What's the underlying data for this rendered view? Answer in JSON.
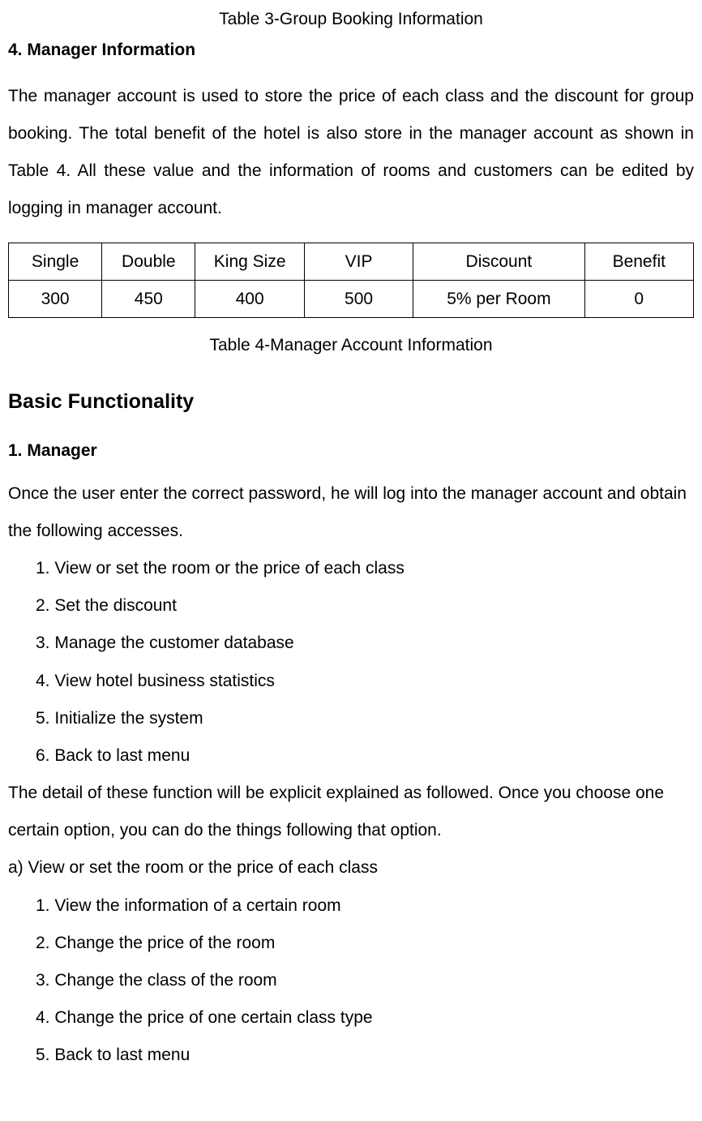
{
  "caption_top": "Table 3-Group Booking Information",
  "section4_heading": "4. Manager Information",
  "section4_para": "The manager account is used to store the price of each class and the discount for group booking. The total benefit of the hotel is also store in the manager account as shown in Table 4. All these value and the information of rooms and customers can be edited by logging in manager account.",
  "chart_data": {
    "type": "table",
    "headers": [
      "Single",
      "Double",
      "King Size",
      "VIP",
      "Discount",
      "Benefit"
    ],
    "rows": [
      [
        "300",
        "450",
        "400",
        "500",
        "5% per Room",
        "0"
      ]
    ],
    "caption": "Table 4-Manager Account Information"
  },
  "basic_heading": "Basic Functionality",
  "manager_heading": "1. Manager",
  "manager_intro": "Once the user enter the correct password, he will log into the manager account and obtain the following accesses.",
  "manager_list": [
    "1. View or set the room or the price of each class",
    "2. Set the discount",
    "3. Manage the customer database",
    "4. View hotel business statistics",
    "5. Initialize the system",
    "6. Back to last menu"
  ],
  "post_list_para1": "The detail of these function will be explicit explained as followed. Once you choose one certain option, you can do the things following that option.",
  "sub_a_heading": "a) View or set the room or the price of each class",
  "sub_a_list": [
    "1. View the information of a certain room",
    "2. Change the price of the room",
    "3. Change the class of the room",
    "4. Change the price of one certain class type",
    "5. Back to last menu"
  ]
}
